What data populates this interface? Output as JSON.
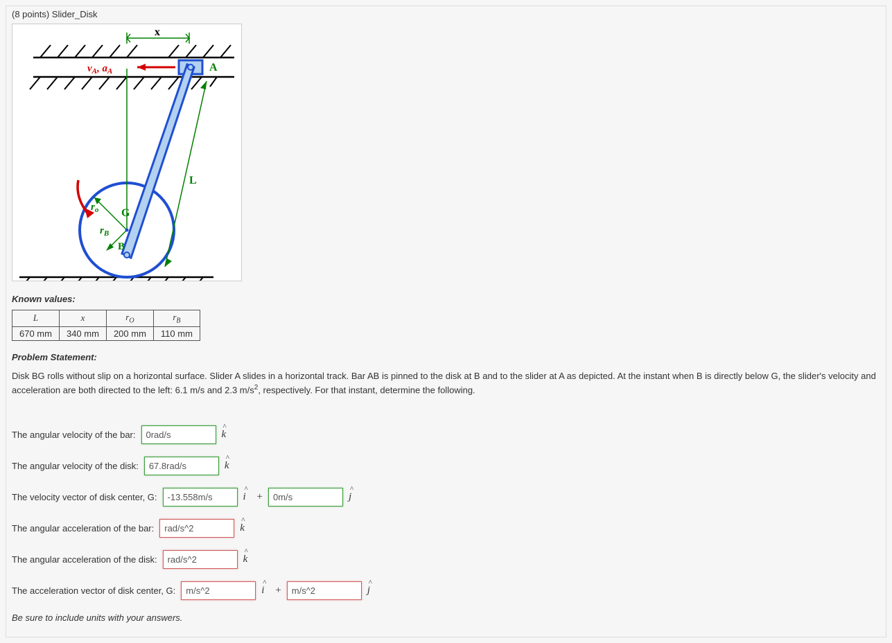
{
  "title": "(8 points) Slider_Disk",
  "figure_labels": {
    "x": "x",
    "va_aa": "vA, aA",
    "A": "A",
    "L": "L",
    "ro": "ro",
    "G": "G",
    "rB": "rB",
    "B": "B"
  },
  "known_values_header": "Known values:",
  "known_table": {
    "symbols": [
      "L",
      "x",
      "rO",
      "rB"
    ],
    "values": [
      "670 mm",
      "340 mm",
      "200 mm",
      "110 mm"
    ]
  },
  "problem_statement_header": "Problem Statement:",
  "problem_statement_text_1": "Disk BG rolls without slip on a horizontal surface. Slider A slides in a horizontal track. Bar AB is pinned to the disk at B and to the slider at A as depicted. At the instant when B is directly below G, the slider's velocity and acceleration are both directed to the left: 6.1 m/s and 2.3 m/s",
  "problem_statement_text_2": ", respectively. For that instant, determine the following.",
  "answers": {
    "bar_omega": {
      "label": "The angular velocity of the bar:",
      "value": "0rad/s",
      "status": "correct",
      "unit": "k"
    },
    "disk_omega": {
      "label": "The angular velocity of the disk:",
      "value": "67.8rad/s",
      "status": "correct",
      "unit": "k"
    },
    "vG": {
      "label": "The velocity vector of disk center, G:",
      "i_value": "-13.558m/s",
      "i_status": "correct",
      "j_value": "0m/s",
      "j_status": "correct"
    },
    "bar_alpha": {
      "label": "The angular acceleration of the bar:",
      "value": "rad/s^2",
      "status": "incorrect",
      "unit": "k"
    },
    "disk_alpha": {
      "label": "The angular acceleration of the disk:",
      "value": "rad/s^2",
      "status": "incorrect",
      "unit": "k"
    },
    "aG": {
      "label": "The acceleration vector of disk center, G:",
      "i_value": "m/s^2",
      "i_status": "incorrect",
      "j_value": "m/s^2",
      "j_status": "incorrect"
    }
  },
  "footer_note": "Be sure to include units with your answers."
}
